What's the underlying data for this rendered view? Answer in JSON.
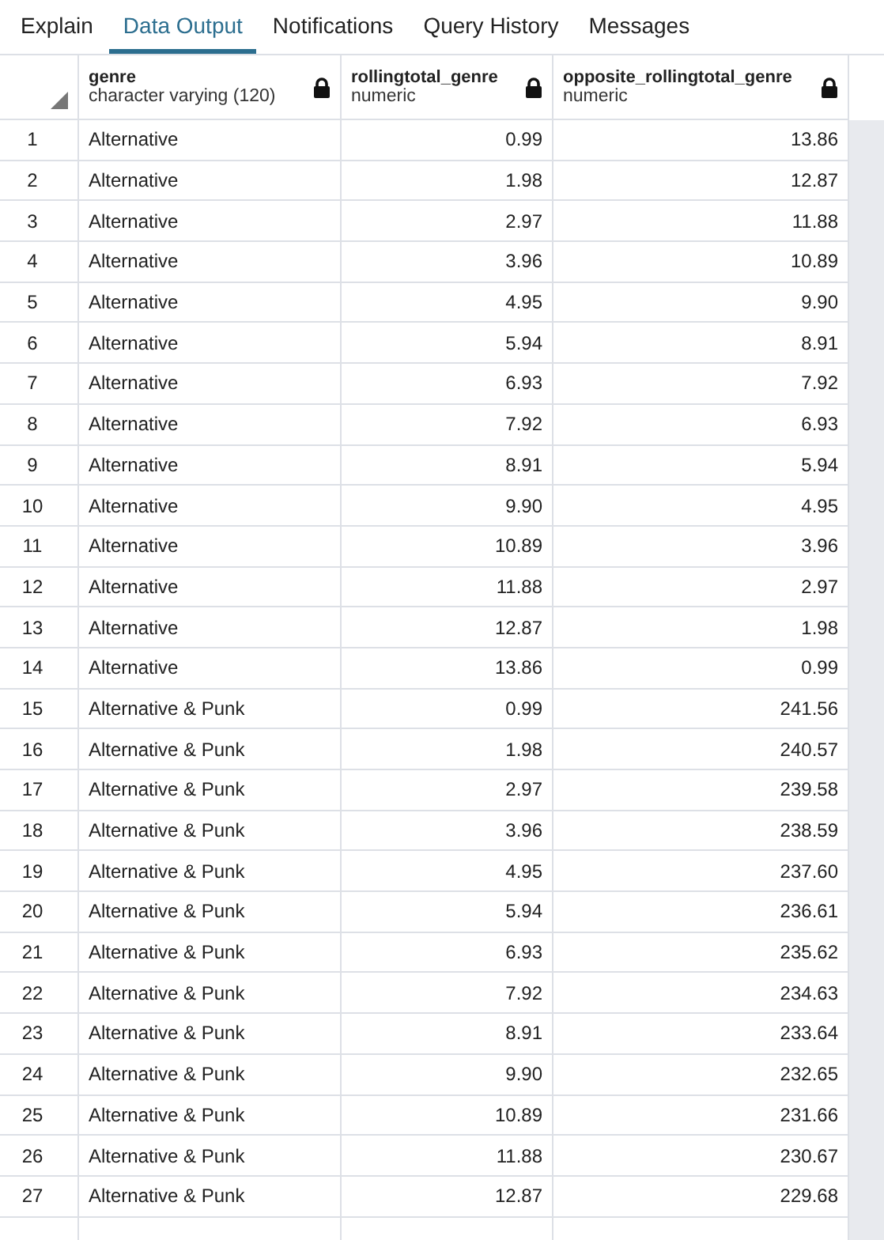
{
  "tabs": [
    {
      "label": "Explain",
      "selected": false
    },
    {
      "label": "Data Output",
      "selected": true
    },
    {
      "label": "Notifications",
      "selected": false
    },
    {
      "label": "Query History",
      "selected": false
    },
    {
      "label": "Messages",
      "selected": false
    }
  ],
  "table": {
    "columns": [
      {
        "name": "genre",
        "type": "character varying (120)",
        "locked": true,
        "kind": "text"
      },
      {
        "name": "rollingtotal_genre",
        "type": "numeric",
        "locked": true,
        "kind": "number"
      },
      {
        "name": "opposite_rollingtotal_genre",
        "type": "numeric",
        "locked": true,
        "kind": "number"
      }
    ],
    "rows": [
      {
        "number": "1",
        "cells": [
          "Alternative",
          "0.99",
          "13.86"
        ]
      },
      {
        "number": "2",
        "cells": [
          "Alternative",
          "1.98",
          "12.87"
        ]
      },
      {
        "number": "3",
        "cells": [
          "Alternative",
          "2.97",
          "11.88"
        ]
      },
      {
        "number": "4",
        "cells": [
          "Alternative",
          "3.96",
          "10.89"
        ]
      },
      {
        "number": "5",
        "cells": [
          "Alternative",
          "4.95",
          "9.90"
        ]
      },
      {
        "number": "6",
        "cells": [
          "Alternative",
          "5.94",
          "8.91"
        ]
      },
      {
        "number": "7",
        "cells": [
          "Alternative",
          "6.93",
          "7.92"
        ]
      },
      {
        "number": "8",
        "cells": [
          "Alternative",
          "7.92",
          "6.93"
        ]
      },
      {
        "number": "9",
        "cells": [
          "Alternative",
          "8.91",
          "5.94"
        ]
      },
      {
        "number": "10",
        "cells": [
          "Alternative",
          "9.90",
          "4.95"
        ]
      },
      {
        "number": "11",
        "cells": [
          "Alternative",
          "10.89",
          "3.96"
        ]
      },
      {
        "number": "12",
        "cells": [
          "Alternative",
          "11.88",
          "2.97"
        ]
      },
      {
        "number": "13",
        "cells": [
          "Alternative",
          "12.87",
          "1.98"
        ]
      },
      {
        "number": "14",
        "cells": [
          "Alternative",
          "13.86",
          "0.99"
        ]
      },
      {
        "number": "15",
        "cells": [
          "Alternative & Punk",
          "0.99",
          "241.56"
        ]
      },
      {
        "number": "16",
        "cells": [
          "Alternative & Punk",
          "1.98",
          "240.57"
        ]
      },
      {
        "number": "17",
        "cells": [
          "Alternative & Punk",
          "2.97",
          "239.58"
        ]
      },
      {
        "number": "18",
        "cells": [
          "Alternative & Punk",
          "3.96",
          "238.59"
        ]
      },
      {
        "number": "19",
        "cells": [
          "Alternative & Punk",
          "4.95",
          "237.60"
        ]
      },
      {
        "number": "20",
        "cells": [
          "Alternative & Punk",
          "5.94",
          "236.61"
        ]
      },
      {
        "number": "21",
        "cells": [
          "Alternative & Punk",
          "6.93",
          "235.62"
        ]
      },
      {
        "number": "22",
        "cells": [
          "Alternative & Punk",
          "7.92",
          "234.63"
        ]
      },
      {
        "number": "23",
        "cells": [
          "Alternative & Punk",
          "8.91",
          "233.64"
        ]
      },
      {
        "number": "24",
        "cells": [
          "Alternative & Punk",
          "9.90",
          "232.65"
        ]
      },
      {
        "number": "25",
        "cells": [
          "Alternative & Punk",
          "10.89",
          "231.66"
        ]
      },
      {
        "number": "26",
        "cells": [
          "Alternative & Punk",
          "11.88",
          "230.67"
        ]
      },
      {
        "number": "27",
        "cells": [
          "Alternative & Punk",
          "12.87",
          "229.68"
        ]
      }
    ]
  }
}
